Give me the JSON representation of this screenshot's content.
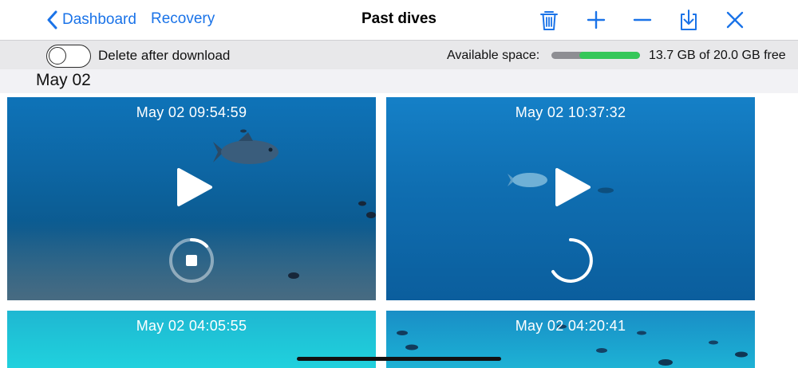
{
  "navbar": {
    "back_label": "Dashboard",
    "recovery_label": "Recovery",
    "title": "Past dives",
    "actions": [
      "trash-icon",
      "plus-icon",
      "minus-icon",
      "download-icon",
      "close-icon"
    ],
    "accent_color": "#1a73e8"
  },
  "toolbar": {
    "delete_toggle_label": "Delete after download",
    "delete_toggle_on": false,
    "space_label": "Available space:",
    "space_value": "13.7 GB of 20.0 GB free",
    "space_free_fraction": 0.685,
    "space_free_color": "#35c759",
    "space_used_color": "#8e8e93"
  },
  "section": {
    "title": "May 02"
  },
  "dives": [
    {
      "timestamp": "May 02 09:54:59",
      "state": "stop"
    },
    {
      "timestamp": "May 02 10:37:32",
      "state": "loading"
    },
    {
      "timestamp": "May 02 04:05:55"
    },
    {
      "timestamp": "May 02 04:20:41"
    }
  ]
}
